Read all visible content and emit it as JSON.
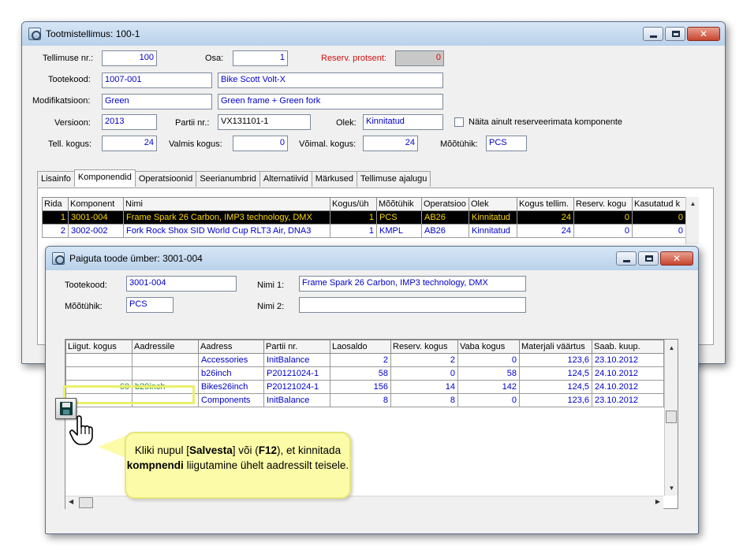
{
  "main_window": {
    "title": "Tootmistellimus: 100-1",
    "fields": {
      "tellimuse_nr_label": "Tellimuse nr.:",
      "tellimuse_nr": "100",
      "osa_label": "Osa:",
      "osa": "1",
      "reserv_label": "Reserv. protsent:",
      "reserv": "0",
      "tootekood_label": "Tootekood:",
      "tootekood": "1007-001",
      "toode_nimi": "Bike Scott Volt-X",
      "modifikatsioon_label": "Modifikatsioon:",
      "modifikatsioon": "Green",
      "modifikatsioon_kirjeldus": "Green frame + Green fork",
      "versioon_label": "Versioon:",
      "versioon": "2013",
      "partii_label": "Partii nr.:",
      "partii": "VX131101-1",
      "olek_label": "Olek:",
      "olek": "Kinnitatud",
      "reserveerimata_label": "Näita ainult reserveerimata komponente",
      "tell_kogus_label": "Tell. kogus:",
      "tell_kogus": "24",
      "valmis_kogus_label": "Valmis kogus:",
      "valmis_kogus": "0",
      "voimal_kogus_label": "Võimal. kogus:",
      "voimal_kogus": "24",
      "mootuhik_label": "Mõõtühik:",
      "mootuhik": "PCS"
    },
    "tabs": [
      "Lisainfo",
      "Komponendid",
      "Operatsioonid",
      "Seerianumbrid",
      "Alternatiivid",
      "Märkused",
      "Tellimuse ajalugu"
    ],
    "active_tab": "Komponendid",
    "grid": {
      "columns": [
        "Rida",
        "Komponent",
        "Nimi",
        "Kogus/üh",
        "Mõõtühik",
        "Operatsioo",
        "Olek",
        "Kogus tellim.",
        "Reserv. kogu",
        "Kasutatud k"
      ],
      "rows": [
        [
          "1",
          "3001-004",
          "Frame Spark 26 Carbon, IMP3 technology, DMX",
          "1",
          "PCS",
          "AB26",
          "Kinnitatud",
          "24",
          "0",
          "0"
        ],
        [
          "2",
          "3002-002",
          "Fork Rock Shox SID World Cup RLT3 Air, DNA3",
          "1",
          "KMPL",
          "AB26",
          "Kinnitatud",
          "24",
          "0",
          "0"
        ]
      ]
    }
  },
  "dialog": {
    "title": "Paiguta toode ümber: 3001-004",
    "tootekood_label": "Tootekood:",
    "tootekood": "3001-004",
    "nimi1_label": "Nimi 1:",
    "nimi1": "Frame Spark 26 Carbon, IMP3 technology, DMX",
    "mootuhik_label": "Mõõtühik:",
    "mootuhik": "PCS",
    "nimi2_label": "Nimi 2:",
    "nimi2": "",
    "grid": {
      "columns": [
        "Liigut. kogus",
        "Aadressile",
        "Aadress",
        "Partii nr.",
        "Laosaldo",
        "Reserv. kogus",
        "Vaba kogus",
        "Materjali väärtus",
        "Saab. kuup."
      ],
      "rows": [
        [
          "",
          "",
          "Accessories",
          "InitBalance",
          "2",
          "2",
          "0",
          "123,6",
          "23.10.2012"
        ],
        [
          "",
          "",
          "b26inch",
          "P20121024-1",
          "58",
          "0",
          "58",
          "124,5",
          "24.10.2012"
        ],
        [
          "60",
          "b29inch",
          "Bikes26inch",
          "P20121024-1",
          "156",
          "14",
          "142",
          "124,5",
          "24.10.2012"
        ],
        [
          "",
          "",
          "Components",
          "InitBalance",
          "8",
          "8",
          "0",
          "123,6",
          "23.10.2012"
        ]
      ]
    }
  },
  "callout": {
    "part1": "Kliki nupul [",
    "bold1": "Salvesta",
    "part2": "] või (",
    "bold2": "F12",
    "part3": "), et kinnitada ",
    "bold3": "kompnendi",
    "part4": " liigutamine ühelt aadressilt teisele."
  },
  "icons": {
    "save": "floppy-disk-icon",
    "cursor": "hand-pointer-icon",
    "window": "app-gear-icon"
  }
}
